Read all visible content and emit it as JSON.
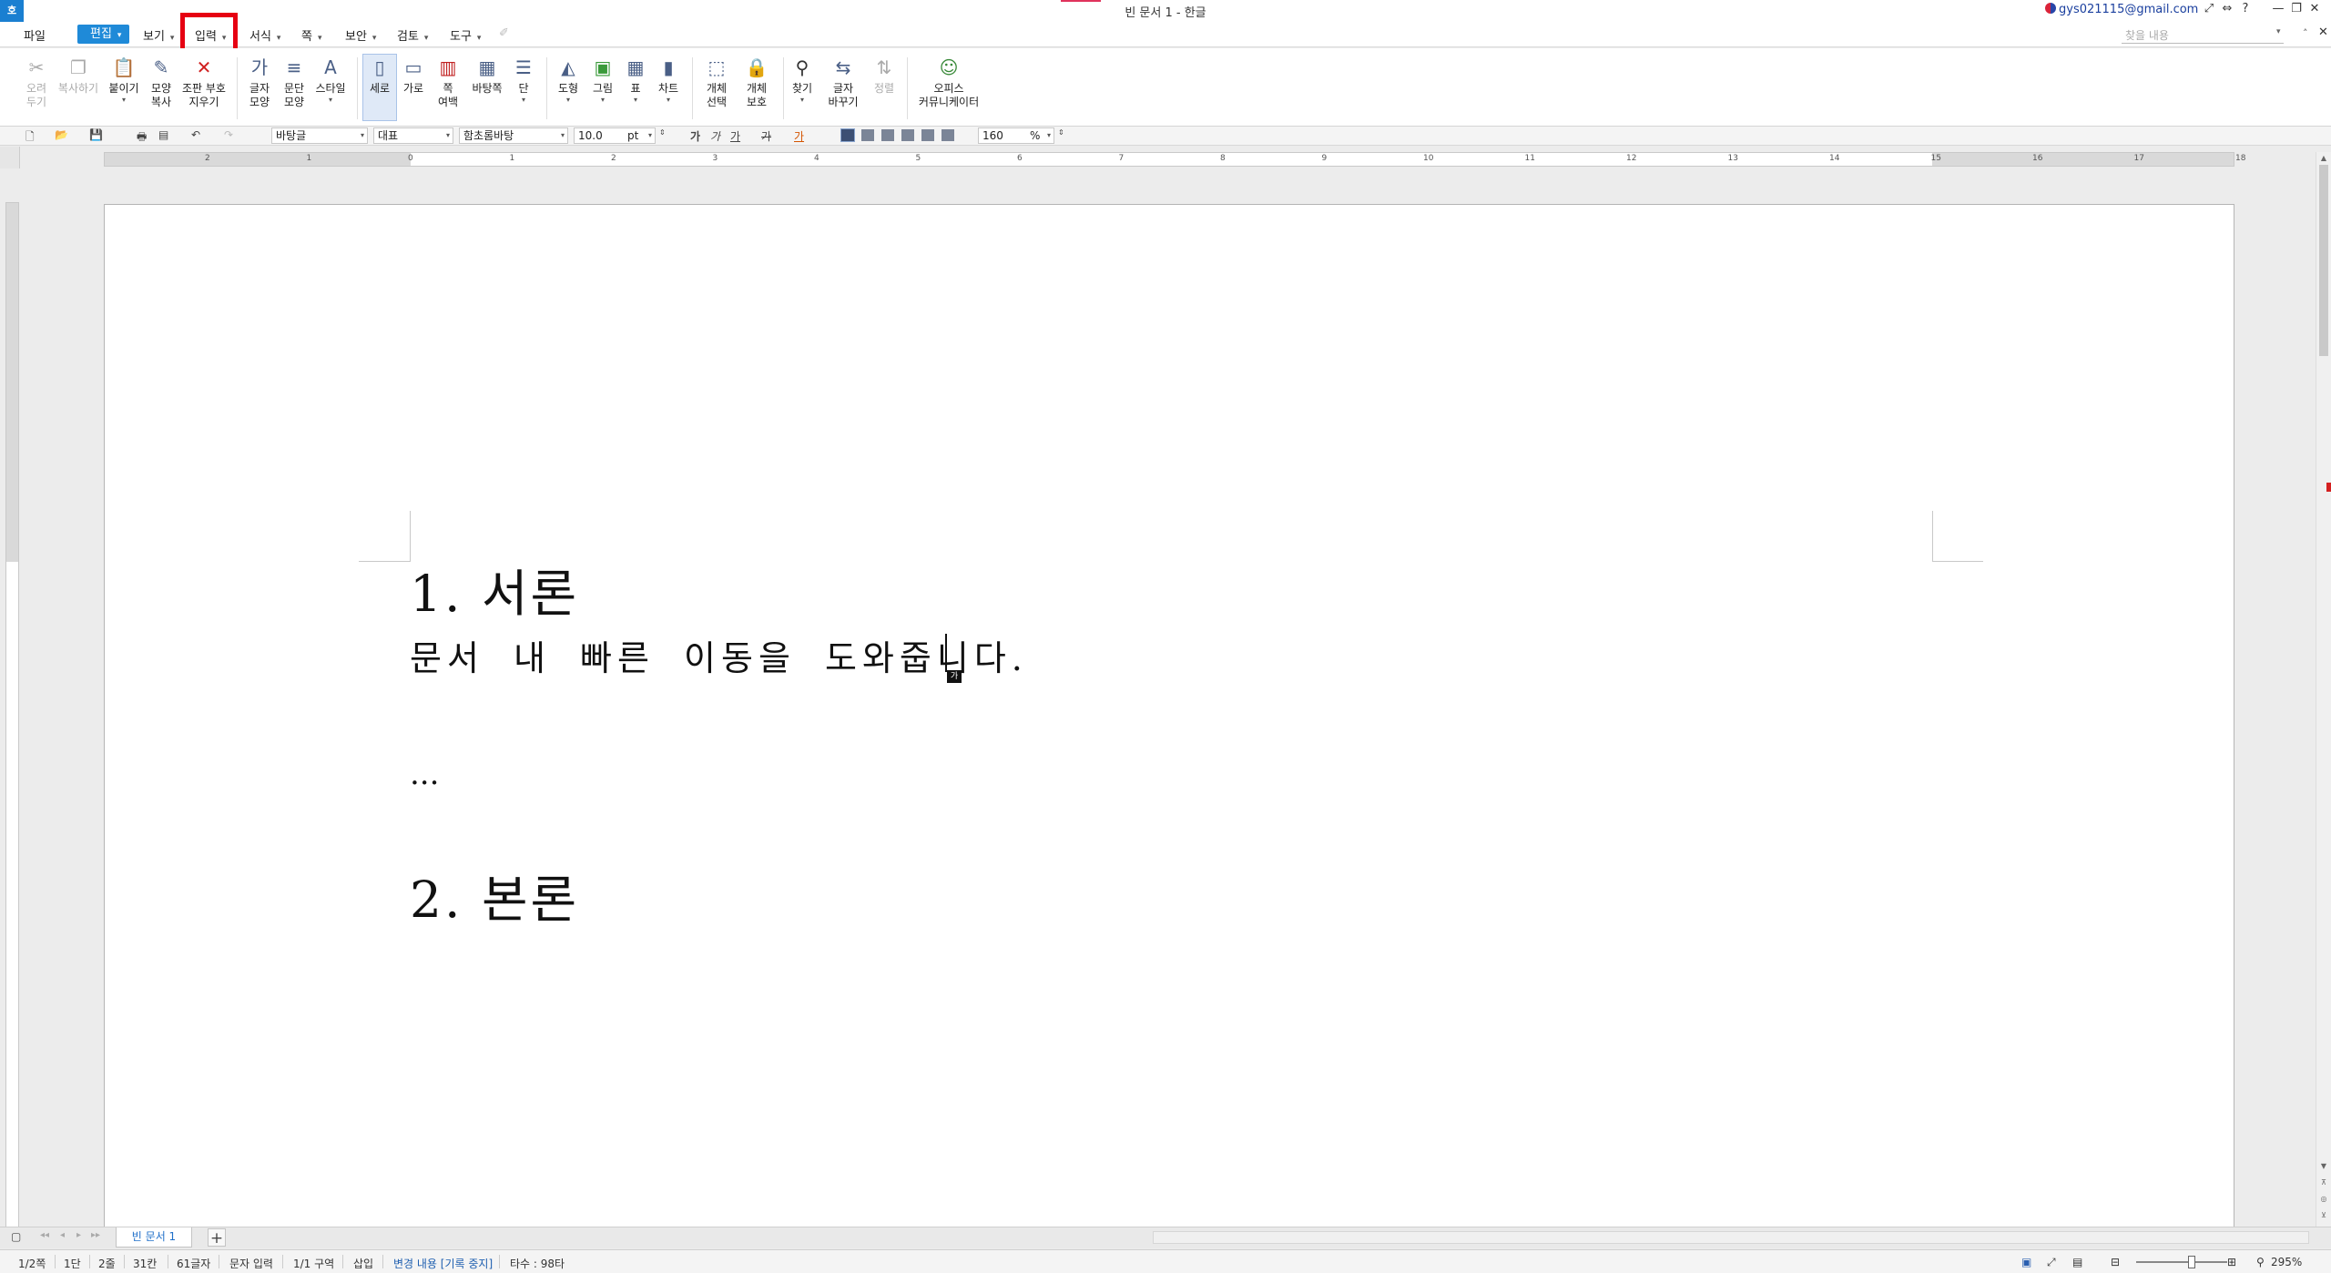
{
  "window": {
    "title": "빈 문서 1 - 한글",
    "app_logo": "호",
    "account": "gys021115@gmail.com",
    "controls": [
      "⤢",
      "⇔",
      "?",
      "—",
      "❐",
      "✕"
    ]
  },
  "menubar": {
    "items": [
      "파일",
      "편집",
      "보기",
      "입력",
      "서식",
      "쪽",
      "보안",
      "검토",
      "도구"
    ],
    "search_placeholder": "찾을 내용",
    "right_caret": "˄",
    "right_close": "✕"
  },
  "ribbon": {
    "cut": "오려\n두기",
    "copy": "복사하기",
    "paste": "붙이기",
    "format_copy": "모양\n복사",
    "clear_marks": "조판 부호\n지우기",
    "char_shape": "글자\n모양",
    "para_shape": "문단\n모양",
    "style": "스타일",
    "portrait": "세로",
    "landscape": "가로",
    "page_margin": "쪽\n여백",
    "background": "바탕쪽",
    "columns": "단",
    "shape": "도형",
    "picture": "그림",
    "table": "표",
    "chart": "차트",
    "object_select": "개체\n선택",
    "object_protect": "개체\n보호",
    "find": "찾기",
    "replace": "글자\n바꾸기",
    "sort": "정렬",
    "office_communicator": "오피스\n커뮤니케이터"
  },
  "fmtbar": {
    "style_name": "바탕글",
    "lang": "대표",
    "font": "함초롬바탕",
    "font_size": "10.0",
    "font_unit": "pt",
    "bold": "가",
    "italic": "가",
    "underline": "가",
    "strike": "가",
    "color": "가",
    "line_spacing": "160",
    "line_spacing_unit": "%"
  },
  "ruler": {
    "numbers": [
      "2",
      "1",
      "0",
      "1",
      "2",
      "3",
      "4",
      "5",
      "6",
      "7",
      "8",
      "9",
      "10",
      "11",
      "12",
      "13",
      "14",
      "15",
      "16",
      "17",
      "18"
    ]
  },
  "document": {
    "heading1": "1. 서론",
    "body1": "문서 내 빠른 이동을 도와줍니다.",
    "ime_badge": "가",
    "ellipsis": "...",
    "heading2": "2. 본론"
  },
  "tabbar": {
    "tab_label": "빈 문서 1",
    "add": "+"
  },
  "statusbar": {
    "page": "1/2쪽",
    "column": "1단",
    "line": "2줄",
    "col": "31칸",
    "chars": "61글자",
    "input_mode": "문자 입력",
    "section": "1/1 구역",
    "insert": "삽입",
    "track": "변경 내용 [기록 중지]",
    "typing": "타수 : 98타",
    "zoom": "295%"
  }
}
